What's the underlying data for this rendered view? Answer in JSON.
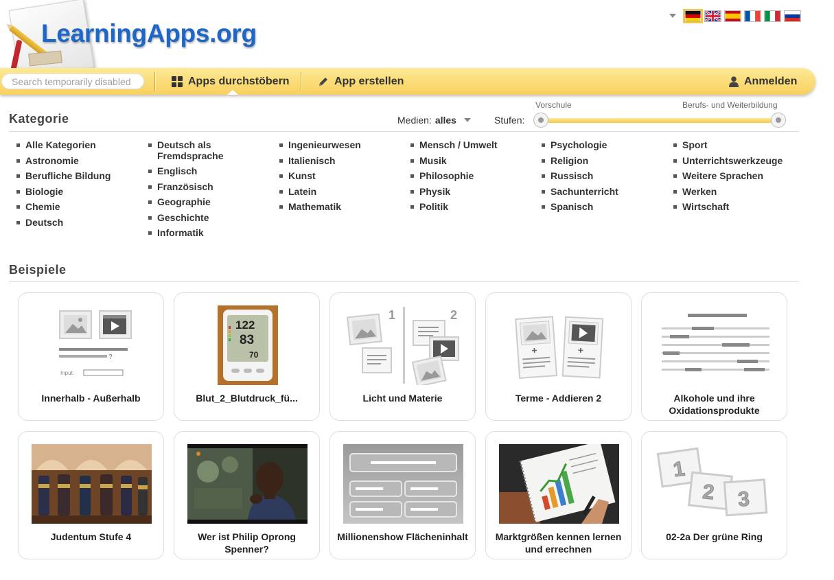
{
  "logo": {
    "text": "LearningApps.org"
  },
  "languages": {
    "flags": [
      {
        "code": "de",
        "active": true
      },
      {
        "code": "en",
        "active": false
      },
      {
        "code": "es",
        "active": false
      },
      {
        "code": "fr",
        "active": false
      },
      {
        "code": "it",
        "active": false
      },
      {
        "code": "ru",
        "active": false
      }
    ]
  },
  "nav": {
    "search_placeholder": "Search temporarily disabled",
    "browse": "Apps durchstöbern",
    "create": "App erstellen",
    "login": "Anmelden"
  },
  "filters": {
    "title": "Kategorie",
    "medien_label": "Medien:",
    "medien_value": "alles",
    "stufen_label": "Stufen:",
    "slider_min": "Vorschule",
    "slider_max": "Berufs- und Weiterbildung"
  },
  "categories": [
    [
      "Alle Kategorien",
      "Astronomie",
      "Berufliche Bildung",
      "Biologie",
      "Chemie",
      "Deutsch"
    ],
    [
      "Deutsch als Fremdsprache",
      "Englisch",
      "Französisch",
      "Geographie",
      "Geschichte",
      "Informatik"
    ],
    [
      "Ingenieurwesen",
      "Italienisch",
      "Kunst",
      "Latein",
      "Mathematik"
    ],
    [
      "Mensch / Umwelt",
      "Musik",
      "Philosophie",
      "Physik",
      "Politik"
    ],
    [
      "Psychologie",
      "Religion",
      "Russisch",
      "Sachunterricht",
      "Spanisch"
    ],
    [
      "Sport",
      "Unterrichtswerkzeuge",
      "Weitere Sprachen",
      "Werken",
      "Wirtschaft"
    ]
  ],
  "examples": {
    "title": "Beispiele",
    "cards": [
      {
        "title": "Innerhalb - Außerhalb",
        "thumb": "media-input-icon"
      },
      {
        "title": "Blut_2_Blutdruck_fü...",
        "thumb": "blood-pressure-photo",
        "display": {
          "top": "122",
          "mid": "83",
          "bottom": "70"
        }
      },
      {
        "title": "Licht und Materie",
        "thumb": "group-assignment-icon",
        "labels": [
          "1",
          "2"
        ]
      },
      {
        "title": "Terme - Addieren 2",
        "thumb": "pairs-icon"
      },
      {
        "title": "Alkohole und ihre Oxidationsprodukte",
        "thumb": "cloze-text-icon"
      },
      {
        "title": "Judentum Stufe 4",
        "thumb": "torah-scrolls-photo"
      },
      {
        "title": "Wer ist Philip Oprong Spenner?",
        "thumb": "video-man-photo"
      },
      {
        "title": "Millionenshow Flächeninhalt",
        "thumb": "quiz-show-icon"
      },
      {
        "title": "Marktgrößen kennen lernen und errechnen",
        "thumb": "chart-notebook-photo"
      },
      {
        "title": "02-2a Der grüne Ring",
        "thumb": "number-order-icon",
        "labels": [
          "1",
          "2",
          "3"
        ]
      }
    ]
  }
}
